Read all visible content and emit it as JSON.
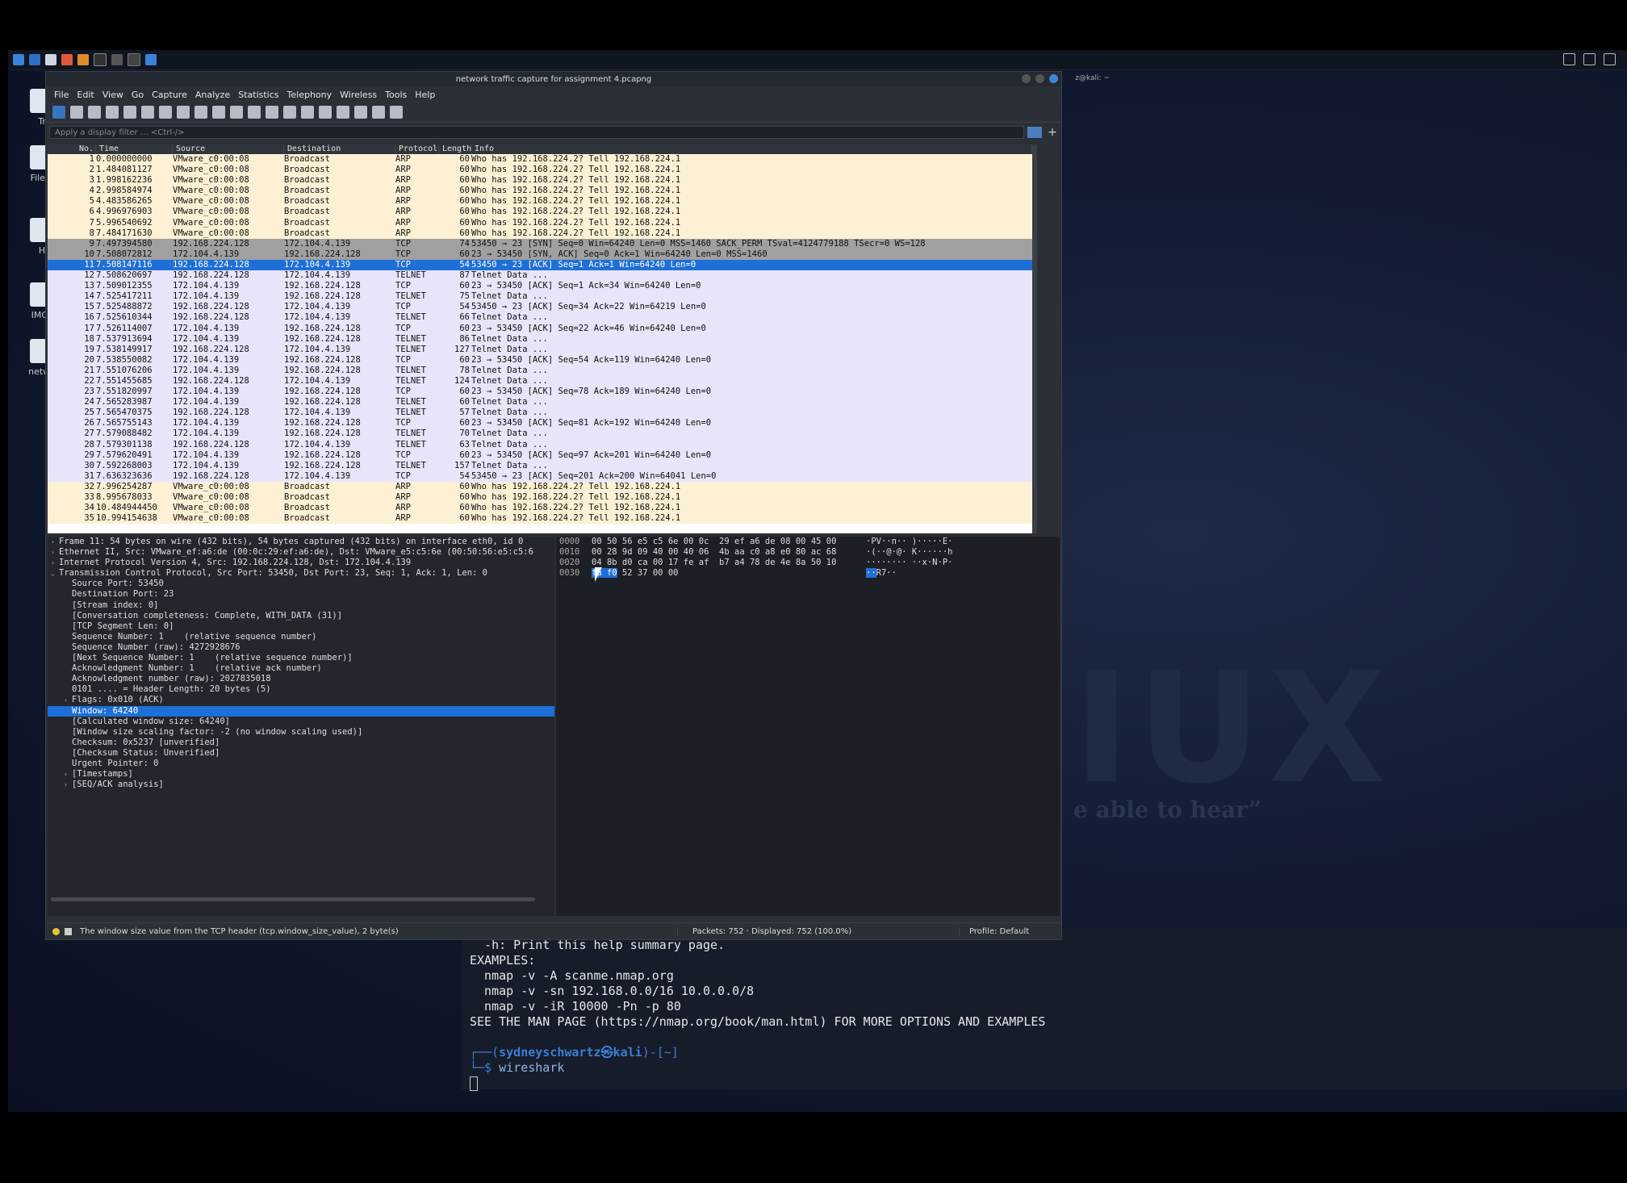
{
  "window": {
    "title": "network traffic capture for assignment 4.pcapng",
    "side_title": "z@kali: ~"
  },
  "desktop": {
    "icons": [
      "Tr",
      "File S",
      "H",
      "IMG_",
      "netwo"
    ],
    "logo_text": "IUX",
    "tagline": "e able to hear”"
  },
  "menu": [
    "File",
    "Edit",
    "View",
    "Go",
    "Capture",
    "Analyze",
    "Statistics",
    "Telephony",
    "Wireless",
    "Tools",
    "Help"
  ],
  "filter": {
    "placeholder": "Apply a display filter … <Ctrl-/>"
  },
  "columns": [
    "No.",
    "Time",
    "Source",
    "Destination",
    "Protocol",
    "Length",
    "Info"
  ],
  "packets": [
    {
      "no": "1",
      "time": "0.000000000",
      "src": "VMware_c0:00:08",
      "dst": "Broadcast",
      "proto": "ARP",
      "len": "60",
      "info": "Who has 192.168.224.2? Tell 192.168.224.1",
      "style": "arp"
    },
    {
      "no": "2",
      "time": "1.484081127",
      "src": "VMware_c0:00:08",
      "dst": "Broadcast",
      "proto": "ARP",
      "len": "60",
      "info": "Who has 192.168.224.2? Tell 192.168.224.1",
      "style": "arp"
    },
    {
      "no": "3",
      "time": "1.998162236",
      "src": "VMware_c0:00:08",
      "dst": "Broadcast",
      "proto": "ARP",
      "len": "60",
      "info": "Who has 192.168.224.2? Tell 192.168.224.1",
      "style": "arp"
    },
    {
      "no": "4",
      "time": "2.998584974",
      "src": "VMware_c0:00:08",
      "dst": "Broadcast",
      "proto": "ARP",
      "len": "60",
      "info": "Who has 192.168.224.2? Tell 192.168.224.1",
      "style": "arp"
    },
    {
      "no": "5",
      "time": "4.483586265",
      "src": "VMware_c0:00:08",
      "dst": "Broadcast",
      "proto": "ARP",
      "len": "60",
      "info": "Who has 192.168.224.2? Tell 192.168.224.1",
      "style": "arp"
    },
    {
      "no": "6",
      "time": "4.996976903",
      "src": "VMware_c0:00:08",
      "dst": "Broadcast",
      "proto": "ARP",
      "len": "60",
      "info": "Who has 192.168.224.2? Tell 192.168.224.1",
      "style": "arp"
    },
    {
      "no": "7",
      "time": "5.996540692",
      "src": "VMware_c0:00:08",
      "dst": "Broadcast",
      "proto": "ARP",
      "len": "60",
      "info": "Who has 192.168.224.2? Tell 192.168.224.1",
      "style": "arp"
    },
    {
      "no": "8",
      "time": "7.484171630",
      "src": "VMware_c0:00:08",
      "dst": "Broadcast",
      "proto": "ARP",
      "len": "60",
      "info": "Who has 192.168.224.2? Tell 192.168.224.1",
      "style": "arp"
    },
    {
      "no": "9",
      "time": "7.497394580",
      "src": "192.168.224.128",
      "dst": "172.104.4.139",
      "proto": "TCP",
      "len": "74",
      "info": "53450 → 23 [SYN] Seq=0 Win=64240 Len=0 MSS=1460 SACK_PERM TSval=4124779188 TSecr=0 WS=128",
      "style": "syn"
    },
    {
      "no": "10",
      "time": "7.508072812",
      "src": "172.104.4.139",
      "dst": "192.168.224.128",
      "proto": "TCP",
      "len": "60",
      "info": "23 → 53450 [SYN, ACK] Seq=0 Ack=1 Win=64240 Len=0 MSS=1460",
      "style": "syn"
    },
    {
      "no": "11",
      "time": "7.508147116",
      "src": "192.168.224.128",
      "dst": "172.104.4.139",
      "proto": "TCP",
      "len": "54",
      "info": "53450 → 23 [ACK] Seq=1 Ack=1 Win=64240 Len=0",
      "style": "sel"
    },
    {
      "no": "12",
      "time": "7.508620697",
      "src": "192.168.224.128",
      "dst": "172.104.4.139",
      "proto": "TELNET",
      "len": "87",
      "info": "Telnet Data ...",
      "style": "tcp"
    },
    {
      "no": "13",
      "time": "7.509012355",
      "src": "172.104.4.139",
      "dst": "192.168.224.128",
      "proto": "TCP",
      "len": "60",
      "info": "23 → 53450 [ACK] Seq=1 Ack=34 Win=64240 Len=0",
      "style": "tcp"
    },
    {
      "no": "14",
      "time": "7.525417211",
      "src": "172.104.4.139",
      "dst": "192.168.224.128",
      "proto": "TELNET",
      "len": "75",
      "info": "Telnet Data ...",
      "style": "tcp"
    },
    {
      "no": "15",
      "time": "7.525488872",
      "src": "192.168.224.128",
      "dst": "172.104.4.139",
      "proto": "TCP",
      "len": "54",
      "info": "53450 → 23 [ACK] Seq=34 Ack=22 Win=64219 Len=0",
      "style": "tcp"
    },
    {
      "no": "16",
      "time": "7.525610344",
      "src": "192.168.224.128",
      "dst": "172.104.4.139",
      "proto": "TELNET",
      "len": "66",
      "info": "Telnet Data ...",
      "style": "tcp"
    },
    {
      "no": "17",
      "time": "7.526114007",
      "src": "172.104.4.139",
      "dst": "192.168.224.128",
      "proto": "TCP",
      "len": "60",
      "info": "23 → 53450 [ACK] Seq=22 Ack=46 Win=64240 Len=0",
      "style": "tcp"
    },
    {
      "no": "18",
      "time": "7.537913694",
      "src": "172.104.4.139",
      "dst": "192.168.224.128",
      "proto": "TELNET",
      "len": "86",
      "info": "Telnet Data ...",
      "style": "tcp"
    },
    {
      "no": "19",
      "time": "7.538149917",
      "src": "192.168.224.128",
      "dst": "172.104.4.139",
      "proto": "TELNET",
      "len": "127",
      "info": "Telnet Data ...",
      "style": "tcp"
    },
    {
      "no": "20",
      "time": "7.538550082",
      "src": "172.104.4.139",
      "dst": "192.168.224.128",
      "proto": "TCP",
      "len": "60",
      "info": "23 → 53450 [ACK] Seq=54 Ack=119 Win=64240 Len=0",
      "style": "tcp"
    },
    {
      "no": "21",
      "time": "7.551076206",
      "src": "172.104.4.139",
      "dst": "192.168.224.128",
      "proto": "TELNET",
      "len": "78",
      "info": "Telnet Data ...",
      "style": "tcp"
    },
    {
      "no": "22",
      "time": "7.551455685",
      "src": "192.168.224.128",
      "dst": "172.104.4.139",
      "proto": "TELNET",
      "len": "124",
      "info": "Telnet Data ...",
      "style": "tcp"
    },
    {
      "no": "23",
      "time": "7.551820997",
      "src": "172.104.4.139",
      "dst": "192.168.224.128",
      "proto": "TCP",
      "len": "60",
      "info": "23 → 53450 [ACK] Seq=78 Ack=189 Win=64240 Len=0",
      "style": "tcp"
    },
    {
      "no": "24",
      "time": "7.565283987",
      "src": "172.104.4.139",
      "dst": "192.168.224.128",
      "proto": "TELNET",
      "len": "60",
      "info": "Telnet Data ...",
      "style": "tcp"
    },
    {
      "no": "25",
      "time": "7.565470375",
      "src": "192.168.224.128",
      "dst": "172.104.4.139",
      "proto": "TELNET",
      "len": "57",
      "info": "Telnet Data ...",
      "style": "tcp"
    },
    {
      "no": "26",
      "time": "7.565755143",
      "src": "172.104.4.139",
      "dst": "192.168.224.128",
      "proto": "TCP",
      "len": "60",
      "info": "23 → 53450 [ACK] Seq=81 Ack=192 Win=64240 Len=0",
      "style": "tcp"
    },
    {
      "no": "27",
      "time": "7.579088482",
      "src": "172.104.4.139",
      "dst": "192.168.224.128",
      "proto": "TELNET",
      "len": "70",
      "info": "Telnet Data ...",
      "style": "tcp"
    },
    {
      "no": "28",
      "time": "7.579301138",
      "src": "192.168.224.128",
      "dst": "172.104.4.139",
      "proto": "TELNET",
      "len": "63",
      "info": "Telnet Data ...",
      "style": "tcp"
    },
    {
      "no": "29",
      "time": "7.579620491",
      "src": "172.104.4.139",
      "dst": "192.168.224.128",
      "proto": "TCP",
      "len": "60",
      "info": "23 → 53450 [ACK] Seq=97 Ack=201 Win=64240 Len=0",
      "style": "tcp"
    },
    {
      "no": "30",
      "time": "7.592268003",
      "src": "172.104.4.139",
      "dst": "192.168.224.128",
      "proto": "TELNET",
      "len": "157",
      "info": "Telnet Data ...",
      "style": "tcp"
    },
    {
      "no": "31",
      "time": "7.636323636",
      "src": "192.168.224.128",
      "dst": "172.104.4.139",
      "proto": "TCP",
      "len": "54",
      "info": "53450 → 23 [ACK] Seq=201 Ack=200 Win=64041 Len=0",
      "style": "tcp"
    },
    {
      "no": "32",
      "time": "7.996254287",
      "src": "VMware_c0:00:08",
      "dst": "Broadcast",
      "proto": "ARP",
      "len": "60",
      "info": "Who has 192.168.224.2? Tell 192.168.224.1",
      "style": "arp"
    },
    {
      "no": "33",
      "time": "8.995678033",
      "src": "VMware_c0:00:08",
      "dst": "Broadcast",
      "proto": "ARP",
      "len": "60",
      "info": "Who has 192.168.224.2? Tell 192.168.224.1",
      "style": "arp"
    },
    {
      "no": "34",
      "time": "10.484944450",
      "src": "VMware_c0:00:08",
      "dst": "Broadcast",
      "proto": "ARP",
      "len": "60",
      "info": "Who has 192.168.224.2? Tell 192.168.224.1",
      "style": "arp"
    },
    {
      "no": "35",
      "time": "10.994154638",
      "src": "VMware_c0:00:08",
      "dst": "Broadcast",
      "proto": "ARP",
      "len": "60",
      "info": "Who has 192.168.224.2? Tell 192.168.224.1",
      "style": "arp"
    }
  ],
  "details": [
    {
      "text": "Frame 11: 54 bytes on wire (432 bits), 54 bytes captured (432 bits) on interface eth0, id 0",
      "tw": "›",
      "indent": false,
      "sel": false
    },
    {
      "text": "Ethernet II, Src: VMware_ef:a6:de (00:0c:29:ef:a6:de), Dst: VMware_e5:c5:6e (00:50:56:e5:c5:6",
      "tw": "›",
      "indent": false,
      "sel": false
    },
    {
      "text": "Internet Protocol Version 4, Src: 192.168.224.128, Dst: 172.104.4.139",
      "tw": "›",
      "indent": false,
      "sel": false
    },
    {
      "text": "Transmission Control Protocol, Src Port: 53450, Dst Port: 23, Seq: 1, Ack: 1, Len: 0",
      "tw": "⌄",
      "indent": false,
      "sel": false
    },
    {
      "text": "Source Port: 53450",
      "tw": "",
      "indent": true,
      "sel": false
    },
    {
      "text": "Destination Port: 23",
      "tw": "",
      "indent": true,
      "sel": false
    },
    {
      "text": "[Stream index: 0]",
      "tw": "",
      "indent": true,
      "sel": false
    },
    {
      "text": "[Conversation completeness: Complete, WITH_DATA (31)]",
      "tw": "",
      "indent": true,
      "sel": false
    },
    {
      "text": "[TCP Segment Len: 0]",
      "tw": "",
      "indent": true,
      "sel": false
    },
    {
      "text": "Sequence Number: 1    (relative sequence number)",
      "tw": "",
      "indent": true,
      "sel": false
    },
    {
      "text": "Sequence Number (raw): 4272928676",
      "tw": "",
      "indent": true,
      "sel": false
    },
    {
      "text": "[Next Sequence Number: 1    (relative sequence number)]",
      "tw": "",
      "indent": true,
      "sel": false
    },
    {
      "text": "Acknowledgment Number: 1    (relative ack number)",
      "tw": "",
      "indent": true,
      "sel": false
    },
    {
      "text": "Acknowledgment number (raw): 2027835018",
      "tw": "",
      "indent": true,
      "sel": false
    },
    {
      "text": "0101 .... = Header Length: 20 bytes (5)",
      "tw": "",
      "indent": true,
      "sel": false
    },
    {
      "text": "Flags: 0x010 (ACK)",
      "tw": "›",
      "indent": true,
      "sel": false
    },
    {
      "text": "Window: 64240",
      "tw": "",
      "indent": true,
      "sel": true
    },
    {
      "text": "[Calculated window size: 64240]",
      "tw": "",
      "indent": true,
      "sel": false
    },
    {
      "text": "[Window size scaling factor: -2 (no window scaling used)]",
      "tw": "",
      "indent": true,
      "sel": false
    },
    {
      "text": "Checksum: 0x5237 [unverified]",
      "tw": "",
      "indent": true,
      "sel": false
    },
    {
      "text": "[Checksum Status: Unverified]",
      "tw": "",
      "indent": true,
      "sel": false
    },
    {
      "text": "Urgent Pointer: 0",
      "tw": "",
      "indent": true,
      "sel": false
    },
    {
      "text": "[Timestamps]",
      "tw": "›",
      "indent": true,
      "sel": false
    },
    {
      "text": "[SEQ/ACK analysis]",
      "tw": "›",
      "indent": true,
      "sel": false
    }
  ],
  "hex": [
    {
      "off": "0000",
      "bytes": "00 50 56 e5 c5 6e 00 0c  29 ef a6 de 08 00 45 00",
      "ascii": "·PV··n·· )·····E·"
    },
    {
      "off": "0010",
      "bytes": "00 28 9d 09 40 00 40 06  4b aa c0 a8 e0 80 ac 68",
      "ascii": "·(··@·@· K······h"
    },
    {
      "off": "0020",
      "bytes": "04 8b d0 ca 00 17 fe af  b7 a4 78 de 4e 8a 50 10",
      "ascii": "········ ··x·N·P·"
    },
    {
      "off": "0030",
      "bytes_hl": "fa f0",
      "bytes": " 52 37 00 00",
      "ascii_hl": "··",
      "ascii": "R7··"
    }
  ],
  "status": {
    "text": "The window size value from the TCP header (tcp.window_size_value), 2 byte(s)",
    "packets": "Packets: 752 · Displayed: 752 (100.0%)",
    "profile": "Profile: Default"
  },
  "terminal": {
    "lines": [
      "  -h: Print this help summary page.",
      "EXAMPLES:",
      "  nmap -v -A scanme.nmap.org",
      "  nmap -v -sn 192.168.0.0/16 10.0.0.0/8",
      "  nmap -v -iR 10000 -Pn -p 80",
      "SEE THE MAN PAGE (https://nmap.org/book/man.html) FOR MORE OPTIONS AND EXAMPLES",
      ""
    ],
    "prompt_open": "┌──(",
    "prompt_user": "sydneyschwartz㉿kali",
    "prompt_close": ")-[~]",
    "prompt_line2": "└─$ ",
    "command": "wireshark"
  },
  "colors": {
    "accent": "#1f6fd8",
    "arp_row": "#fdf0d4",
    "tcp_row": "#e6e5fa",
    "syn_row": "#a0a0a0"
  }
}
